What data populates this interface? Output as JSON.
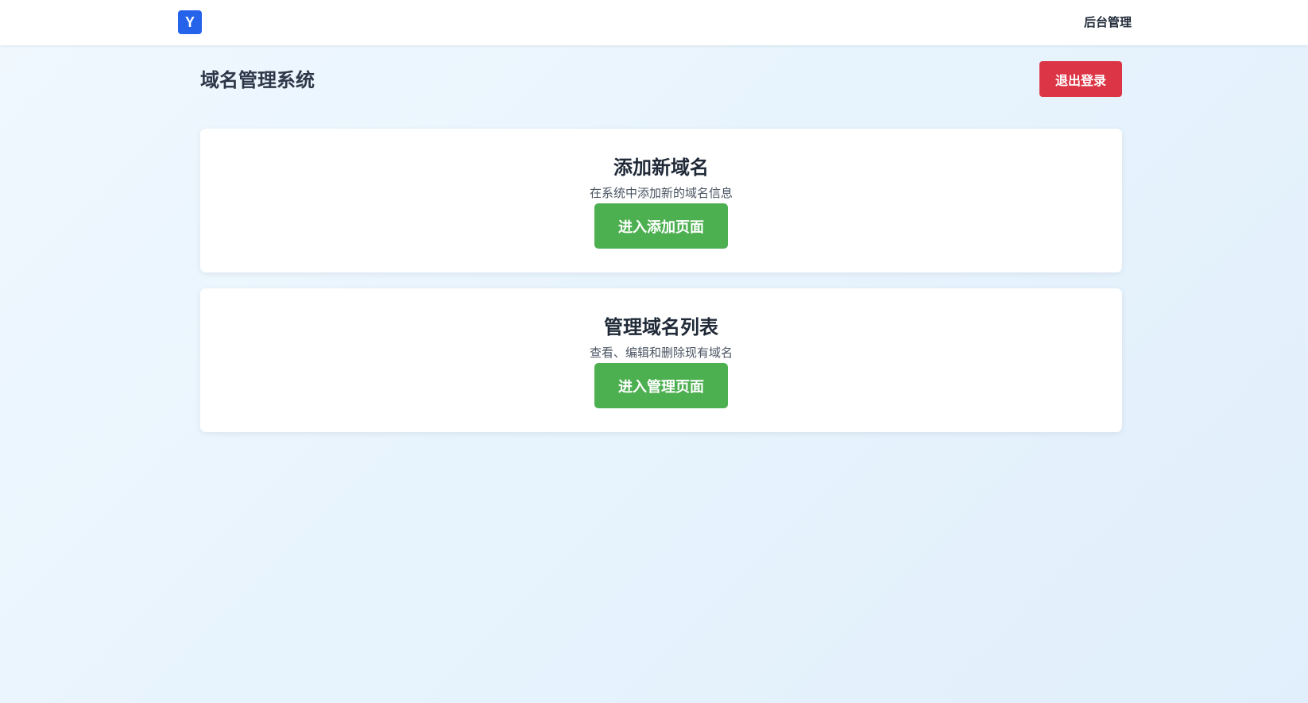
{
  "header": {
    "logo_letter": "Y",
    "admin_link": "后台管理"
  },
  "page": {
    "title": "域名管理系统",
    "logout_label": "退出登录"
  },
  "cards": [
    {
      "title": "添加新域名",
      "description": "在系统中添加新的域名信息",
      "button_label": "进入添加页面"
    },
    {
      "title": "管理域名列表",
      "description": "查看、编辑和删除现有域名",
      "button_label": "进入管理页面"
    }
  ],
  "colors": {
    "logo_bg": "#2563eb",
    "logout_bg": "#dc3545",
    "action_bg": "#4caf50",
    "page_bg": "#e8f4fd"
  },
  "icons": {
    "logo": "letter-y-logo"
  }
}
